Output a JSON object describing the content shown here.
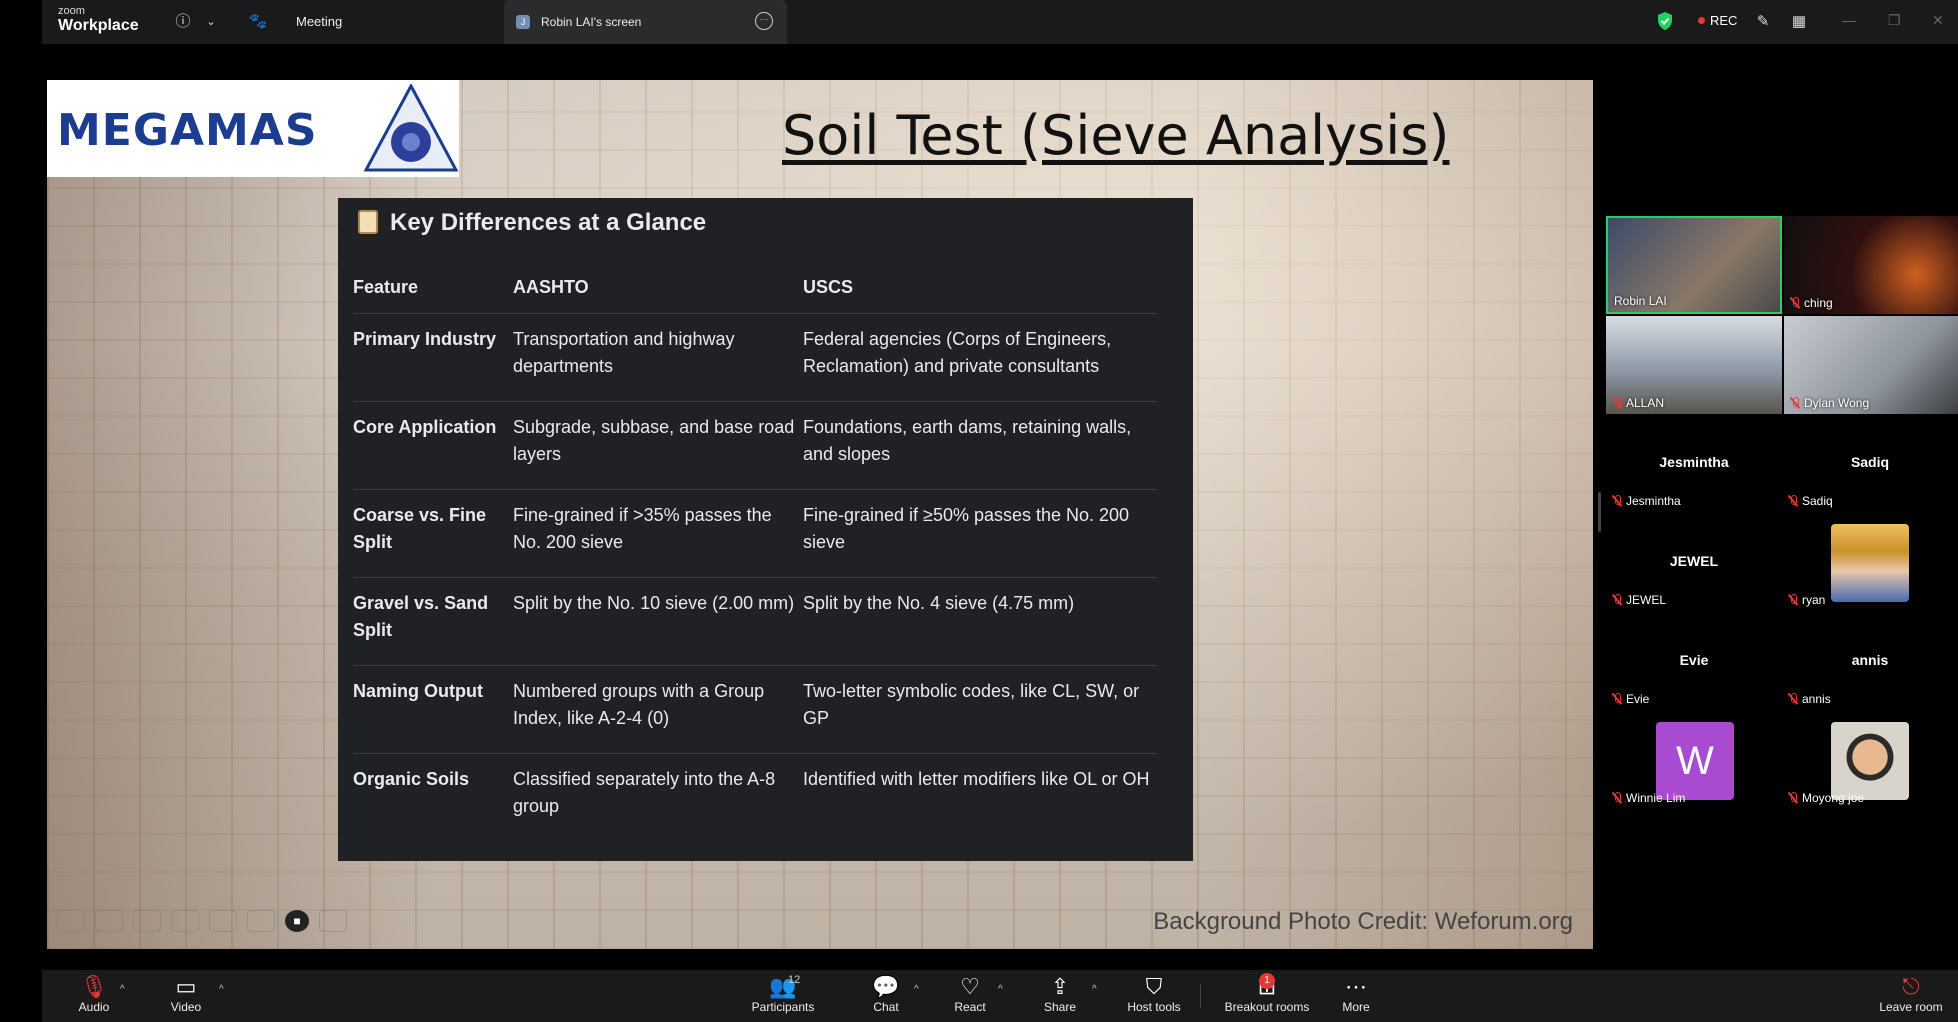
{
  "app": {
    "brand_small": "zoom",
    "brand_name": "Workplace",
    "meeting_label": "Meeting"
  },
  "share_tab": {
    "initial": "J",
    "title": "Robin LAI's screen"
  },
  "status": {
    "rec_label": "REC"
  },
  "slide": {
    "logo_text": "MEGAMAS",
    "title": "Soil Test (Sieve Analysis)",
    "table_heading": "Key Differences at a Glance",
    "columns": [
      "Feature",
      "AASHTO",
      "USCS"
    ],
    "rows": [
      {
        "feature": "Primary Industry",
        "aashto": "Transportation and highway departments",
        "uscs": "Federal agencies (Corps of Engineers, Reclamation) and private consultants"
      },
      {
        "feature": "Core Application",
        "aashto": "Subgrade, subbase, and base road layers",
        "uscs": "Foundations, earth dams, retaining walls, and slopes"
      },
      {
        "feature": "Coarse vs. Fine Split",
        "aashto": "Fine-grained if >35% passes the No. 200 sieve",
        "uscs": "Fine-grained if ≥50% passes the No. 200 sieve"
      },
      {
        "feature": "Gravel vs. Sand Split",
        "aashto": "Split by the No. 10 sieve (2.00 mm)",
        "uscs": "Split by the No. 4 sieve (4.75 mm)"
      },
      {
        "feature": "Naming Output",
        "aashto": "Numbered groups with a Group Index, like A-2-4 (0)",
        "uscs": "Two-letter symbolic codes, like CL, SW, or GP"
      },
      {
        "feature": "Organic Soils",
        "aashto": "Classified separately into the A-8 group",
        "uscs": "Identified with letter modifiers like OL or OH"
      }
    ],
    "credit": "Background Photo Credit: Weforum.org"
  },
  "participants": [
    {
      "name": "Robin LAI",
      "muted": false
    },
    {
      "name": "ching",
      "muted": true
    },
    {
      "name": "ALLAN",
      "muted": true
    },
    {
      "name": "Dylan Wong",
      "muted": true
    },
    {
      "name": "Jesmintha",
      "muted": true
    },
    {
      "name": "Sadiq",
      "muted": true
    },
    {
      "name": "JEWEL",
      "muted": true
    },
    {
      "name": "ryan",
      "muted": true
    },
    {
      "name": "Evie",
      "muted": true
    },
    {
      "name": "annis",
      "muted": true
    },
    {
      "name": "Winnie Lim",
      "muted": true,
      "avatar_letter": "W"
    },
    {
      "name": "Moyong joe",
      "muted": true
    }
  ],
  "toolbar": {
    "audio": "Audio",
    "video": "Video",
    "participants": "Participants",
    "participants_count": "12",
    "chat": "Chat",
    "react": "React",
    "share": "Share",
    "host_tools": "Host tools",
    "breakout": "Breakout rooms",
    "breakout_badge": "1",
    "more": "More",
    "leave": "Leave room"
  },
  "colors": {
    "accent_green": "#23d160",
    "rec_red": "#e53935",
    "logo_blue": "#1b3c8f",
    "avatar_purple": "#a94bd0"
  }
}
